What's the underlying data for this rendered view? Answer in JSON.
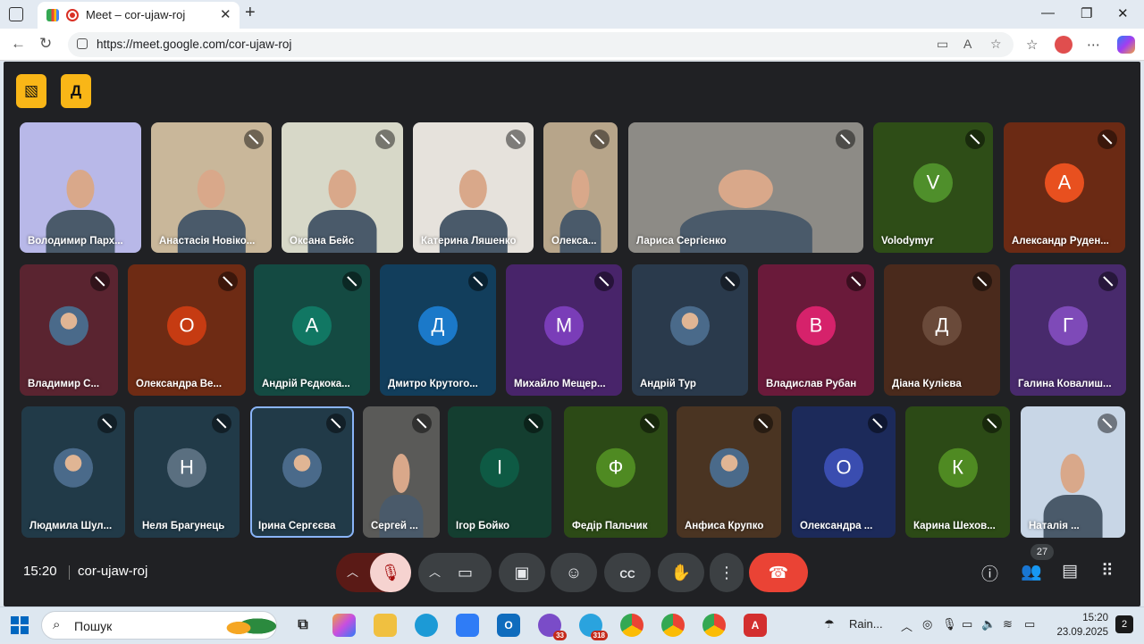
{
  "browser": {
    "tab_title": "Meet – cor-ujaw-roj",
    "url": "https://meet.google.com/cor-ujaw-roj"
  },
  "meeting": {
    "time": "15:20",
    "code": "cor-ujaw-roj",
    "participant_count": "27"
  },
  "participants": [
    {
      "name": "Володимир Парх...",
      "kind": "video",
      "bg": "#b8b8e8"
    },
    {
      "name": "Анастасія Новіко...",
      "kind": "video",
      "bg": "#c9b79a"
    },
    {
      "name": "Оксана Бейс",
      "kind": "video",
      "bg": "#d7d8c8"
    },
    {
      "name": "Катерина Ляшенко",
      "kind": "video",
      "bg": "#e6e2dc"
    },
    {
      "name": "Олекса...",
      "kind": "video",
      "bg": "#b7a58a"
    },
    {
      "name": "Лариса Сергієнко",
      "kind": "video",
      "bg": "#8d8b86"
    },
    {
      "name": "Volodymyr",
      "kind": "letter",
      "letter": "V",
      "bg": "#2e4d17",
      "avatar": "#4f8f2b"
    },
    {
      "name": "Александр Руден...",
      "kind": "letter",
      "letter": "А",
      "bg": "#6b2a14",
      "avatar": "#e8501f"
    },
    {
      "name": "Владимир С...",
      "kind": "pic",
      "bg": "#5a2430"
    },
    {
      "name": "Олександра Ве...",
      "kind": "letter",
      "letter": "О",
      "bg": "#6e2b14",
      "avatar": "#c63b12"
    },
    {
      "name": "Андрій Рєдкока...",
      "kind": "letter",
      "letter": "А",
      "bg": "#144a42",
      "avatar": "#117763"
    },
    {
      "name": "Дмитро Крутого...",
      "kind": "letter",
      "letter": "Д",
      "bg": "#123e5c",
      "avatar": "#1b79c9"
    },
    {
      "name": "Михайло Мещер...",
      "kind": "letter",
      "letter": "М",
      "bg": "#48246a",
      "avatar": "#7a3db8"
    },
    {
      "name": "Андрій Тур",
      "kind": "pic",
      "bg": "#2a3a4c"
    },
    {
      "name": "Владислав Рубан",
      "kind": "letter",
      "letter": "В",
      "bg": "#6a1a3a",
      "avatar": "#d6226b"
    },
    {
      "name": "Діана Кулієва",
      "kind": "letter",
      "letter": "Д",
      "bg": "#4a2a1c",
      "avatar": "#6a4a3a"
    },
    {
      "name": "Галина Ковалиш...",
      "kind": "letter",
      "letter": "Г",
      "bg": "#482a6c",
      "avatar": "#7e4ab8"
    },
    {
      "name": "Людмила Шул...",
      "kind": "pic",
      "bg": "#213a48"
    },
    {
      "name": "Неля Брагунець",
      "kind": "letter",
      "letter": "Н",
      "bg": "#213a48",
      "avatar": "#5a6f80"
    },
    {
      "name": "Ірина Сергєєва",
      "kind": "pic",
      "bg": "#213a48"
    },
    {
      "name": "Сергей ...",
      "kind": "video",
      "bg": "#5a5a58"
    },
    {
      "name": "Ігор Бойко",
      "kind": "letter",
      "letter": "І",
      "bg": "#143e30",
      "avatar": "#0e5a44"
    },
    {
      "name": "Федір Пальчик",
      "kind": "letter",
      "letter": "Ф",
      "bg": "#2c4a16",
      "avatar": "#4f8a22"
    },
    {
      "name": "Анфиса Крупко",
      "kind": "pic",
      "bg": "#4a3422"
    },
    {
      "name": "Олександра ...",
      "kind": "letter",
      "letter": "О",
      "bg": "#1c2a5a",
      "avatar": "#3a4db0"
    },
    {
      "name": "Карина Шехов...",
      "kind": "letter",
      "letter": "К",
      "bg": "#2c4a16",
      "avatar": "#4f8a22"
    },
    {
      "name": "Наталія ...",
      "kind": "video",
      "bg": "#c8d6e6"
    }
  ],
  "taskbar": {
    "search_placeholder": "Пошук",
    "weather": "Rain...",
    "clock_time": "15:20",
    "clock_date": "23.09.2025",
    "notifications": "2",
    "viber_badge": "33",
    "telegram_badge": "318"
  }
}
